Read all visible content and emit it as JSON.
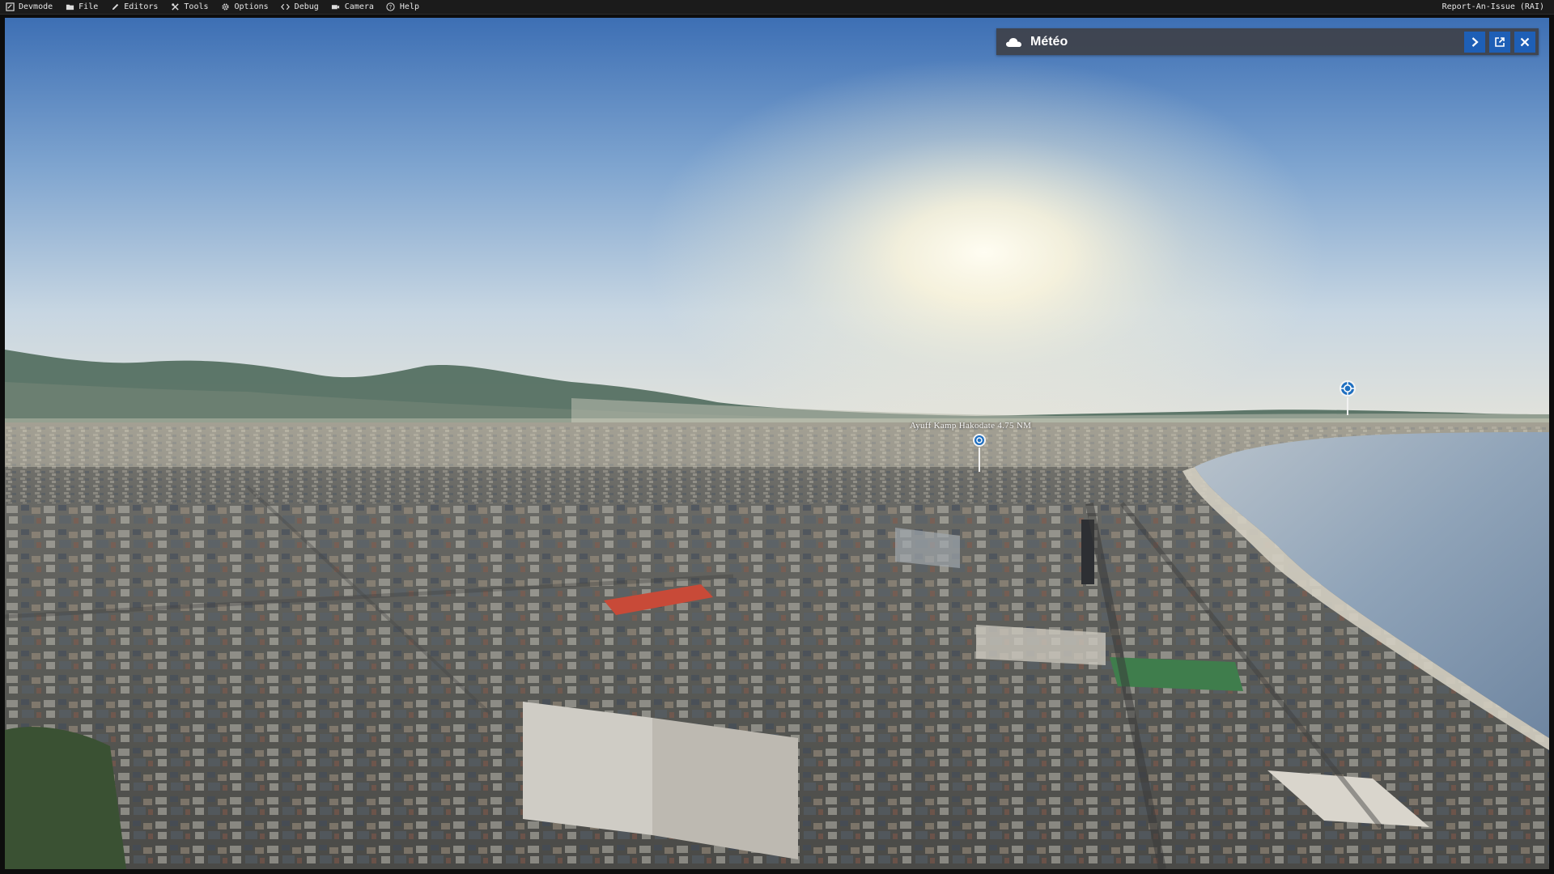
{
  "menubar": {
    "items": [
      {
        "label": "Devmode",
        "icon": "devmode-icon"
      },
      {
        "label": "File",
        "icon": "folder-icon"
      },
      {
        "label": "Editors",
        "icon": "pencil-icon"
      },
      {
        "label": "Tools",
        "icon": "tools-icon"
      },
      {
        "label": "Options",
        "icon": "gear-icon"
      },
      {
        "label": "Debug",
        "icon": "code-icon"
      },
      {
        "label": "Camera",
        "icon": "camera-icon"
      },
      {
        "label": "Help",
        "icon": "help-icon"
      }
    ],
    "report_label": "Report-An-Issue (RAI)"
  },
  "meteo_panel": {
    "title": "Météo",
    "icon": "cloud-icon",
    "buttons": [
      "chevron-right-icon",
      "popout-icon",
      "close-icon"
    ],
    "accent_color": "#1e5fb6"
  },
  "world": {
    "poi_label": "Ayuff Kamp Hakodate 4.75 NM",
    "markers": [
      "airport-marker-icon",
      "target-marker-icon"
    ]
  }
}
